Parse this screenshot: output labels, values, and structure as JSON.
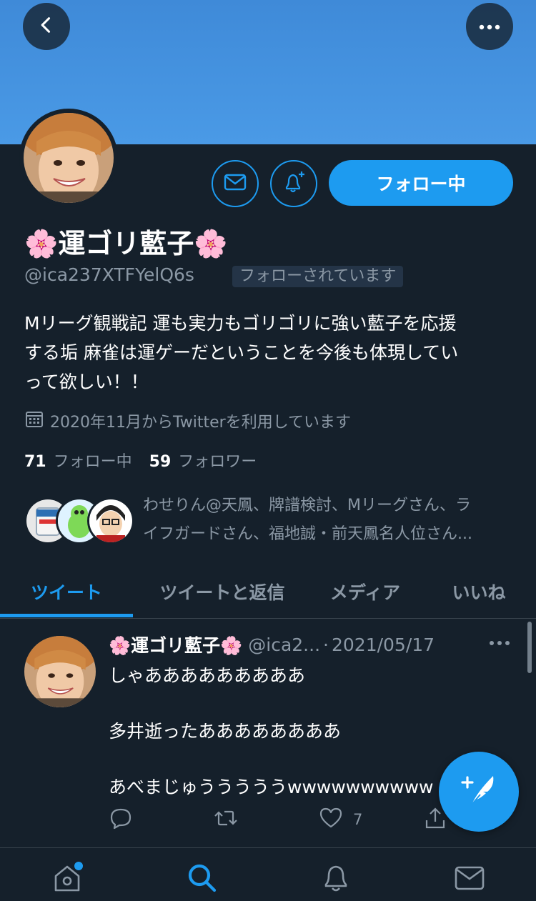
{
  "profile": {
    "display_name": "🌸運ゴリ藍子🌸",
    "handle": "@ica237XTFYelQ6s",
    "follows_you_badge": "フォローされています",
    "follow_button_label": "フォロー中",
    "bio_line1": "Mリーグ観戦記 運も実力もゴリゴリに強い藍子を応援",
    "bio_line2": "する垢 麻雀は運ゲーだということを今後も体現してい",
    "bio_line3": "って欲しい！！",
    "joined": "2020年11月からTwitterを利用しています",
    "following_count": "71",
    "following_label": "フォロー中",
    "followers_count": "59",
    "followers_label": "フォロワー",
    "mutuals_line1": "わせりん@天鳳、牌譜検討、Mリーグさん、ラ",
    "mutuals_line2": "イフガードさん、福地誠・前天鳳名人位さん..."
  },
  "tabs": [
    "ツイート",
    "ツイートと返信",
    "メディア",
    "いいね"
  ],
  "tweet": {
    "name": "🌸運ゴリ藍子🌸",
    "handle": "@ica2...",
    "dot": "·",
    "date": "2021/05/17",
    "line1": "しゃあああああああああ",
    "line2": "多井逝ったああああああああ",
    "line3": "あべまじゅうううううwwwwwwwwww",
    "like_count": "7"
  },
  "icons": {
    "back": "chevron-left-icon",
    "more": "ellipsis-icon",
    "message": "envelope-icon",
    "notify": "bell-plus-icon",
    "calendar": "calendar-icon",
    "reply": "reply-icon",
    "retweet": "retweet-icon",
    "like": "heart-icon",
    "share": "share-icon",
    "compose": "compose-feather-icon",
    "home": "home-icon",
    "search": "search-icon",
    "notifications": "bell-icon",
    "messages": "envelope-icon"
  },
  "colors": {
    "background": "#15202b",
    "accent": "#1d9bf0",
    "secondary_text": "#8b98a5",
    "banner": "#4a9ae6"
  }
}
